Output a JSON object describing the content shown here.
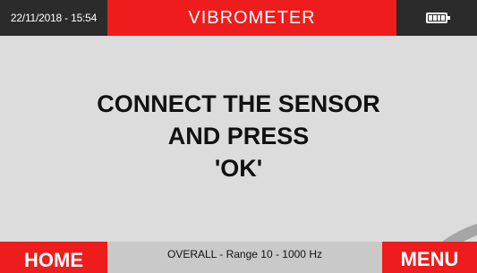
{
  "header": {
    "datetime": "22/11/2018 - 15:54",
    "title": "VIBROMETER",
    "battery_icon": "battery-full-icon",
    "battery_level": 1.0
  },
  "message": {
    "line1": "CONNECT THE SENSOR",
    "line2": "AND PRESS",
    "line3": "'OK'"
  },
  "footer": {
    "home_label": "HOME",
    "status_text": "OVERALL - Range 10 - 1000 Hz",
    "menu_label": "MENU"
  },
  "colors": {
    "accent_red": "#ee1c1c",
    "header_dark": "#2b2b2b",
    "background": "#dcdcdc"
  }
}
